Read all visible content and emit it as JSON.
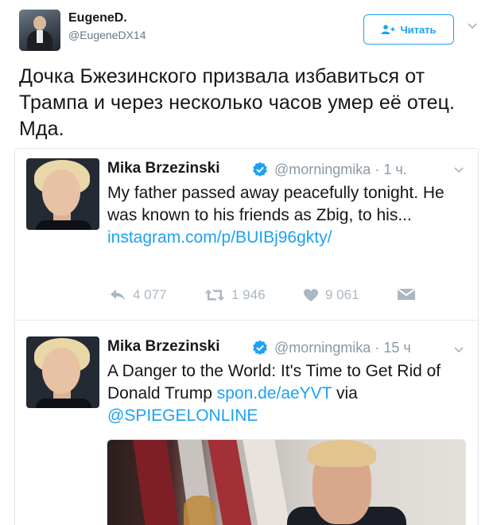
{
  "outer_tweet": {
    "author_name": "EugeneD.",
    "author_handle": "@EugeneDX14",
    "follow_label": "Читать",
    "text": "Дочка Бжезинского призвала избавиться от Трампа и через несколько часов умер её отец. Мда."
  },
  "quoted_tweets": [
    {
      "author_name": "Mika Brzezinski",
      "author_handle": "@morningmika",
      "time": "· 1 ч.",
      "text": "My father passed away peacefully tonight. He was known to his friends as Zbig, to his...",
      "link": "instagram.com/p/BUIBj96gkty/",
      "actions": {
        "reply_count": "4 077",
        "retweet_count": "1 946",
        "like_count": "9 061"
      }
    },
    {
      "author_name": "Mika Brzezinski",
      "author_handle": "@morningmika",
      "time": "· 15 ч",
      "text": "A Danger to the World: It's Time to Get Rid of Donald Trump",
      "link": "spon.de/aeYVT",
      "via": "via",
      "mention": "@SPIEGELONLINE"
    }
  ],
  "icons": {
    "follow": "add-user-icon",
    "caret": "chevron-down-icon",
    "verified": "verified-badge-icon",
    "reply": "reply-icon",
    "retweet": "retweet-icon",
    "like": "heart-icon",
    "dm": "envelope-icon"
  },
  "colors": {
    "accent": "#1da1f2",
    "muted": "#8899a6",
    "action_gray": "#aab8c2",
    "border": "#e1e8ed"
  }
}
